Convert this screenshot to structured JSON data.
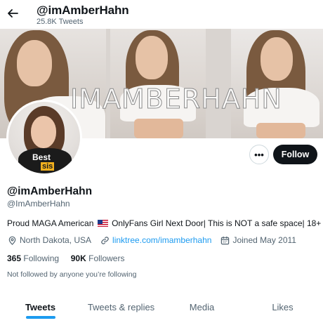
{
  "header": {
    "title": "@imAmberHahn",
    "tweet_count": "25.8K Tweets"
  },
  "banner": {
    "watermark": "IMAMBERHAHN"
  },
  "avatar": {
    "shirt_text_top": "Best",
    "shirt_text_bottom": "sis"
  },
  "actions": {
    "more": "•••",
    "follow": "Follow"
  },
  "profile": {
    "display_name": "@imAmberHahn",
    "handle": "@ImAmberHahn",
    "bio_before_flag": "Proud MAGA American",
    "bio_after_flag": "OnlyFans Girl Next Door| This is NOT a safe space| 18+",
    "location": "North Dakota, USA",
    "link": "linktree.com/imamberhahn",
    "joined": "Joined May 2011"
  },
  "stats": {
    "following_count": "365",
    "following_label": "Following",
    "followers_count": "90K",
    "followers_label": "Followers"
  },
  "followed_by": "Not followed by anyone you’re following",
  "tabs": [
    {
      "label": "Tweets",
      "active": true
    },
    {
      "label": "Tweets & replies",
      "active": false
    },
    {
      "label": "Media",
      "active": false
    },
    {
      "label": "Likes",
      "active": false
    }
  ],
  "colors": {
    "accent": "#1d9bf0",
    "text": "#0f1419",
    "muted": "#536471"
  },
  "icons": [
    "back-arrow-icon",
    "location-pin-icon",
    "link-icon",
    "calendar-icon",
    "more-icon"
  ]
}
